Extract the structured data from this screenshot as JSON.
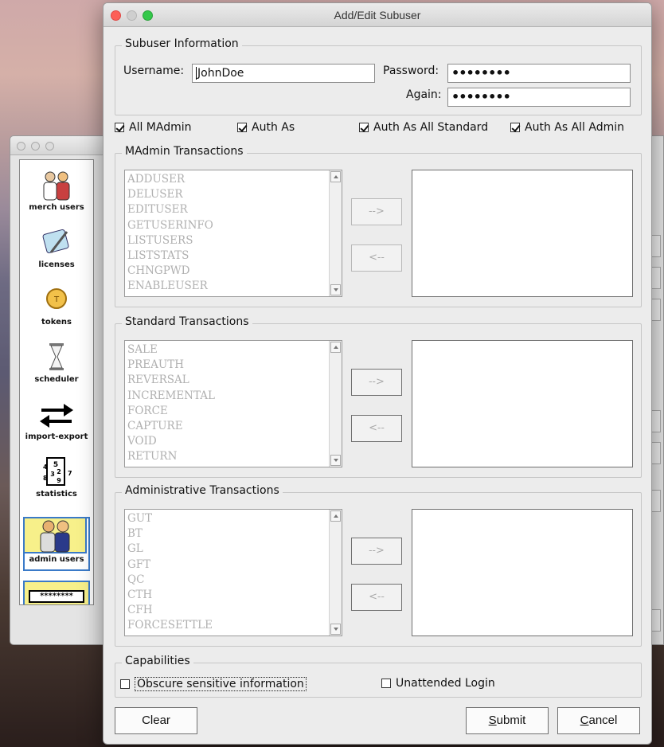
{
  "window_title": "Add/Edit Subuser",
  "subuser_info": {
    "title": "Subuser Information",
    "username_label": "Username:",
    "username_value": "JohnDoe",
    "password_label": "Password:",
    "password_value": "••••••••",
    "again_label": "Again:",
    "again_value": "••••••••"
  },
  "options": {
    "all_madmin": "All MAdmin",
    "auth_as": "Auth As",
    "auth_as_all_standard": "Auth As All Standard",
    "auth_as_all_admin": "Auth As All Admin"
  },
  "madmin": {
    "title": "MAdmin Transactions",
    "items": [
      "ADDUSER",
      "DELUSER",
      "EDITUSER",
      "GETUSERINFO",
      "LISTUSERS",
      "LISTSTATS",
      "CHNGPWD",
      "ENABLEUSER"
    ],
    "add_label": "-->",
    "remove_label": "<--"
  },
  "standard": {
    "title": "Standard Transactions",
    "items": [
      "SALE",
      "PREAUTH",
      "REVERSAL",
      "INCREMENTAL",
      "FORCE",
      "CAPTURE",
      "VOID",
      "RETURN"
    ],
    "add_label": "-->",
    "remove_label": "<--"
  },
  "administrative": {
    "title": "Administrative Transactions",
    "items": [
      "GUT",
      "BT",
      "GL",
      "GFT",
      "QC",
      "CTH",
      "CFH",
      "FORCESETTLE"
    ],
    "add_label": "-->",
    "remove_label": "<--"
  },
  "capabilities": {
    "title": "Capabilities",
    "obscure_label": "Obscure sensitive information",
    "unattended_label": "Unattended Login"
  },
  "buttons": {
    "clear": "Clear",
    "submit_first": "S",
    "submit_rest": "ubmit",
    "cancel_first": "C",
    "cancel_rest": "ancel"
  },
  "sidebar": {
    "items": [
      {
        "label": "merch users",
        "icon": "users-icon"
      },
      {
        "label": "licenses",
        "icon": "certificate-icon"
      },
      {
        "label": "tokens",
        "icon": "token-icon"
      },
      {
        "label": "scheduler",
        "icon": "hourglass-icon"
      },
      {
        "label": "import-export",
        "icon": "exchange-arrows-icon"
      },
      {
        "label": "statistics",
        "icon": "statistics-icon"
      },
      {
        "label": "admin users",
        "icon": "admin-users-icon"
      }
    ],
    "partial_label": "********"
  }
}
